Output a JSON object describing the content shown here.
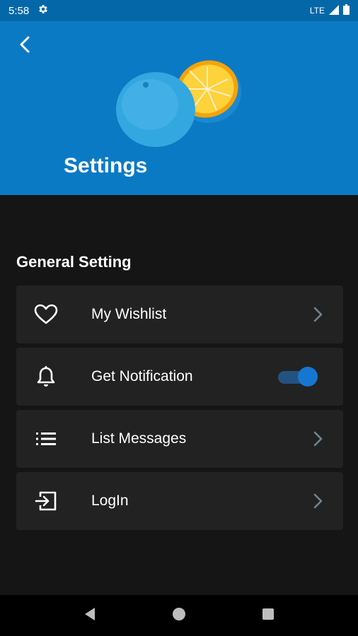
{
  "status_bar": {
    "time": "5:58",
    "network": "LTE",
    "settings_icon": "gear-icon",
    "signal_icon": "signal-icon",
    "battery_icon": "battery-icon"
  },
  "header": {
    "back_icon": "chevron-left-icon",
    "image": "orange-half-image",
    "title": "Settings",
    "background_color": "#0b7ac5"
  },
  "section": {
    "title": "General Setting"
  },
  "items": [
    {
      "label": "My Wishlist",
      "icon": "heart-icon",
      "trailing": "chevron-right-icon"
    },
    {
      "label": "Get Notification",
      "icon": "bell-icon",
      "trailing": "toggle",
      "toggle_on": true
    },
    {
      "label": "List Messages",
      "icon": "list-icon",
      "trailing": "chevron-right-icon"
    },
    {
      "label": "LogIn",
      "icon": "login-icon",
      "trailing": "chevron-right-icon"
    }
  ],
  "nav_bar": {
    "back": "triangle-back-icon",
    "home": "circle-home-icon",
    "recents": "square-recents-icon"
  },
  "colors": {
    "accent": "#1677d2",
    "card": "#222222",
    "background": "#151515"
  }
}
